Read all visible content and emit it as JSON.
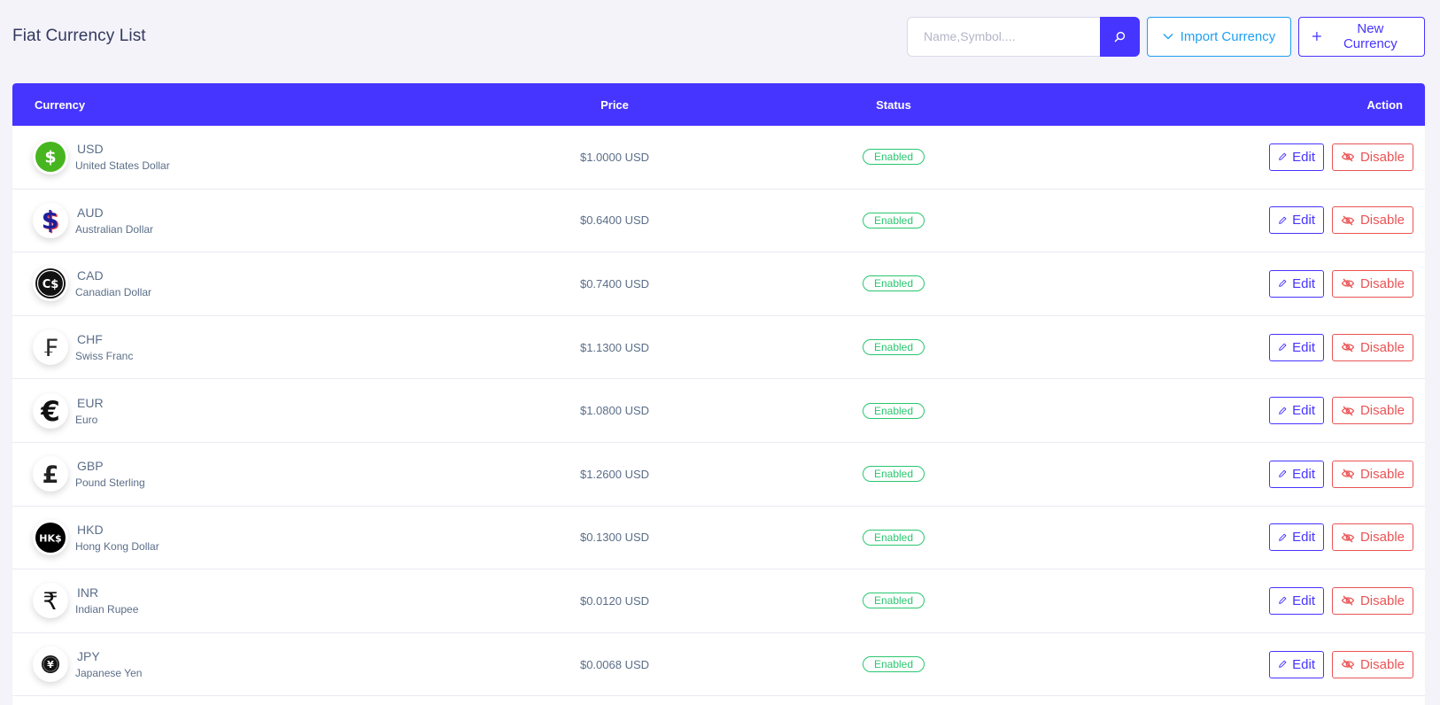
{
  "page": {
    "title": "Fiat Currency List"
  },
  "search": {
    "placeholder": "Name,Symbol...."
  },
  "toolbar": {
    "import_label": "Import Currency",
    "new_label": "New Currency"
  },
  "colors": {
    "primary": "#4634ff",
    "info": "#1e9ff2",
    "success": "#28c76f",
    "danger": "#ea5455"
  },
  "table": {
    "headers": {
      "currency": "Currency",
      "price": "Price",
      "status": "Status",
      "action": "Action"
    },
    "rows": [
      {
        "code": "USD",
        "name": "United States Dollar",
        "price": "$1.0000 USD",
        "status": "Enabled",
        "icon": "green-dollar-icon"
      },
      {
        "code": "AUD",
        "name": "Australian Dollar",
        "price": "$0.6400 USD",
        "status": "Enabled",
        "icon": "aud-dollar-icon"
      },
      {
        "code": "CAD",
        "name": "Canadian Dollar",
        "price": "$0.7400 USD",
        "status": "Enabled",
        "icon": "cad-dollar-icon"
      },
      {
        "code": "CHF",
        "name": "Swiss Franc",
        "price": "$1.1300 USD",
        "status": "Enabled",
        "icon": "franc-icon"
      },
      {
        "code": "EUR",
        "name": "Euro",
        "price": "$1.0800 USD",
        "status": "Enabled",
        "icon": "euro-icon"
      },
      {
        "code": "GBP",
        "name": "Pound Sterling",
        "price": "$1.2600 USD",
        "status": "Enabled",
        "icon": "pound-icon"
      },
      {
        "code": "HKD",
        "name": "Hong Kong Dollar",
        "price": "$0.1300 USD",
        "status": "Enabled",
        "icon": "hkd-icon"
      },
      {
        "code": "INR",
        "name": "Indian Rupee",
        "price": "$0.0120 USD",
        "status": "Enabled",
        "icon": "rupee-icon"
      },
      {
        "code": "JPY",
        "name": "Japanese Yen",
        "price": "$0.0068 USD",
        "status": "Enabled",
        "icon": "yen-icon"
      }
    ],
    "actions": {
      "edit": "Edit",
      "disable": "Disable"
    }
  }
}
